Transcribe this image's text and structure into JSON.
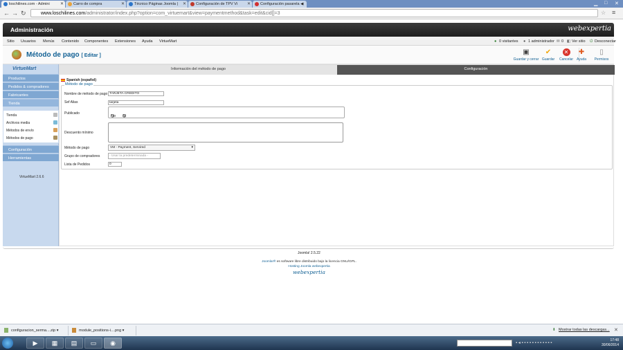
{
  "browser": {
    "tabs": [
      {
        "label": "loschilines.com - Admini",
        "active": true,
        "color": "#2c75c9"
      },
      {
        "label": "Carro de compra",
        "active": false,
        "color": "#e8a33c"
      },
      {
        "label": "Técnico Páginas Joomla |",
        "active": false,
        "color": "#2c75c9"
      },
      {
        "label": "Configuración de TPV Vi",
        "active": false,
        "color": "#c0392b"
      },
      {
        "label": "Configuración pasarela ◀",
        "active": false,
        "color": "#d32f2f"
      }
    ],
    "url_domain": "www.loschilines.com",
    "url_path": "/administrator/index.php?option=com_virtuemart&view=paymentmethod&task=edit&cid[]=3"
  },
  "admin": {
    "title": "Administración",
    "logo": "webexpertia",
    "top_menu": [
      "Sitio",
      "Usuarios",
      "Menús",
      "Contenido",
      "Componentes",
      "Extensiones",
      "Ayuda",
      "VirtueMart"
    ],
    "status": {
      "visitors": "0 visitantes",
      "admins": "1 administrador",
      "messages": "0",
      "view_site": "Ver sitio",
      "logout": "Desconectar"
    }
  },
  "page": {
    "title": "Método de pago",
    "edit_label": "[ Editar ]"
  },
  "toolbar": {
    "save_close": "Guardar y cerrar",
    "save": "Guardar",
    "cancel": "Cancelar",
    "help": "Ayuda",
    "permissions": "Permisos"
  },
  "sidebar": {
    "logo": "VirtueMart",
    "groups": [
      "Productos",
      "Pedidos & compradores",
      "Fabricantes",
      "Tienda"
    ],
    "items": [
      "Tienda",
      "Archivos media",
      "Métodos de envío",
      "Métodos de pago"
    ],
    "bottom_groups": [
      "Configuración",
      "Herramientas"
    ],
    "version": "VirtueMart 2.6.6"
  },
  "tabs": {
    "info": "Información del método de pago",
    "config": "Configuración"
  },
  "form": {
    "language": "Spanish (español)",
    "legend": "Método de pago",
    "name_label": "Nombre de método de pago",
    "name_value": "TARJETA CREDITO",
    "alias_label": "Sef Alias",
    "alias_value": "tarjeta",
    "published_label": "Publicado",
    "published_no": "No",
    "published_yes": "Sí",
    "published_value": "Sí",
    "description_label": "Descuento mínimo",
    "method_label": "Método de pago",
    "method_value": "VM - Payment, Servired",
    "group_label": "Grupo de compradores",
    "group_placeholder": "- Usar la predeterminada -",
    "order_label": "Lista de Pedidos",
    "order_value": "0"
  },
  "footer": {
    "joomla_version": "Joomla! 2.5.22",
    "license_link": "Joomla!®",
    "license_text": "es software libre distribuido bajo la licencia GNU/GPL.",
    "hosting": "Hosting Joomla webexpertia",
    "logo": "webexpertia"
  },
  "downloads": {
    "items": [
      "configuracion_serma....zip",
      "module_positions-i....png"
    ],
    "show_all": "Mostrar todas las descargas..."
  },
  "taskbar": {
    "time": "17:48",
    "date": "30/06/2014"
  }
}
